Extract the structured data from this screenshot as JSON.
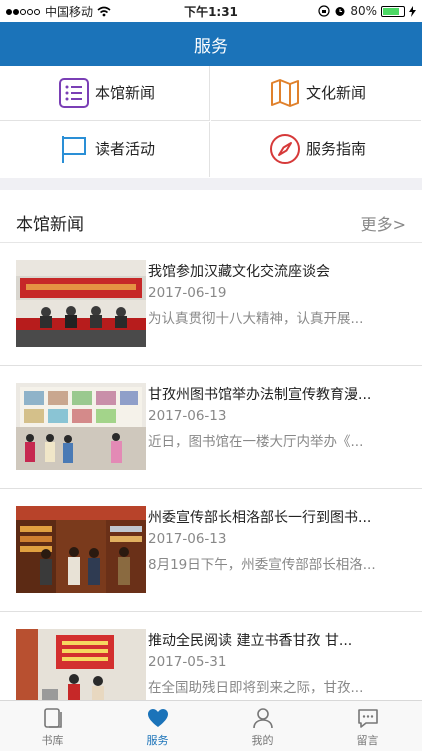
{
  "status_bar": {
    "carrier": "中国移动",
    "time": "下午1:31",
    "battery": "80%",
    "battery_level": 0.8
  },
  "nav": {
    "title": "服务"
  },
  "grid": [
    {
      "label": "本馆新闻",
      "icon": "list-icon",
      "color": "#7a3fb5"
    },
    {
      "label": "文化新闻",
      "icon": "map-icon",
      "color": "#e0812c"
    },
    {
      "label": "读者活动",
      "icon": "flag-icon",
      "color": "#2a8fd6"
    },
    {
      "label": "服务指南",
      "icon": "compass-icon",
      "color": "#d63a3a"
    }
  ],
  "news_section": {
    "title": "本馆新闻",
    "more": "更多>",
    "items": [
      {
        "title": "我馆参加汉藏文化交流座谈会",
        "date": "2017-06-19",
        "summary": "为认真贯彻十八大精神，认真开展..."
      },
      {
        "title": "甘孜州图书馆举办法制宣传教育漫...",
        "date": "2017-06-13",
        "summary": "近日，图书馆在一楼大厅内举办《..."
      },
      {
        "title": "州委宣传部长相洛部长一行到图书...",
        "date": "2017-06-13",
        "summary": "8月19日下午，州委宣传部部长相洛..."
      },
      {
        "title": "推动全民阅读 建立书香甘孜 甘...",
        "date": "2017-05-31",
        "summary": "在全国助残日即将到来之际，甘孜..."
      }
    ]
  },
  "tabs": [
    {
      "label": "书库",
      "icon": "book-icon"
    },
    {
      "label": "服务",
      "icon": "heart-icon",
      "active": true
    },
    {
      "label": "我的",
      "icon": "person-icon"
    },
    {
      "label": "留言",
      "icon": "message-icon"
    }
  ]
}
